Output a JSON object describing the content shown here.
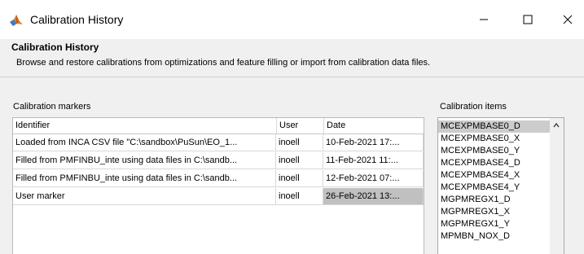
{
  "window": {
    "title": "Calibration History",
    "minimize_glyph": "—",
    "maximize_glyph": "☐",
    "close_glyph": "✕"
  },
  "header": {
    "heading": "Calibration History",
    "description": "Browse and restore calibrations from optimizations and feature filling or import from calibration data files."
  },
  "markers": {
    "label": "Calibration markers",
    "columns": {
      "identifier": "Identifier",
      "user": "User",
      "date": "Date"
    },
    "rows": [
      {
        "identifier": "Loaded from INCA CSV file \"C:\\sandbox\\PuSun\\EO_1...",
        "user": "inoell",
        "date": "10-Feb-2021 17:..."
      },
      {
        "identifier": "Filled from PMFINBU_inte using data files in C:\\sandb...",
        "user": "inoell",
        "date": "11-Feb-2021 11:..."
      },
      {
        "identifier": "Filled from PMFINBU_inte using data files in C:\\sandb...",
        "user": "inoell",
        "date": "12-Feb-2021 07:..."
      },
      {
        "identifier": "User marker",
        "user": "inoell",
        "date": "26-Feb-2021 13:..."
      }
    ],
    "selected_row": 3
  },
  "items": {
    "label": "Calibration items",
    "list": [
      "MCEXPMBASE0_D",
      "MCEXPMBASE0_X",
      "MCEXPMBASE0_Y",
      "MCEXPMBASE4_D",
      "MCEXPMBASE4_X",
      "MCEXPMBASE4_Y",
      "MGPMREGX1_D",
      "MGPMREGX1_X",
      "MGPMREGX1_Y",
      "MPMBN_NOX_D"
    ],
    "selected_index": 0
  },
  "colors": {
    "selection": "#cccccc",
    "title_bar": "#ffffff",
    "dialog_bg": "#f0f0f0"
  },
  "icons": {
    "app": "matlab-membrane-icon",
    "scroll_up": "chevron-up-icon"
  }
}
